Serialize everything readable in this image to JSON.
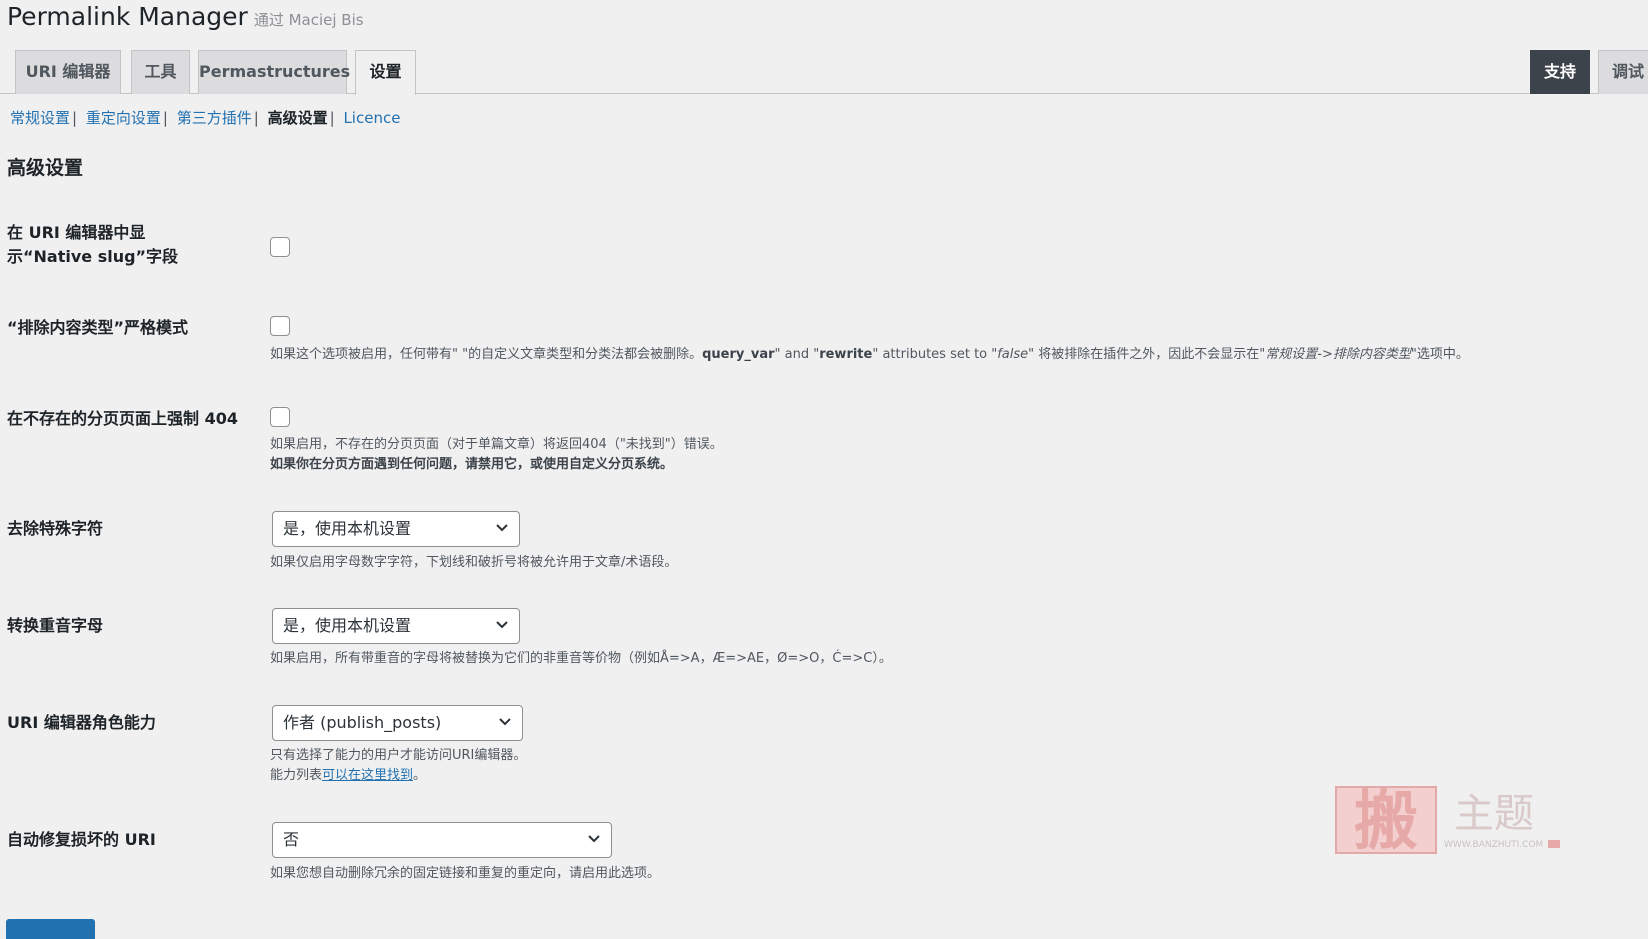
{
  "header": {
    "title": "Permalink Manager",
    "author": "通过 Maciej Bis"
  },
  "tabs": [
    {
      "label": "URI 编辑器"
    },
    {
      "label": "工具"
    },
    {
      "label": "Permastructures"
    },
    {
      "label": "设置",
      "active": true
    }
  ],
  "right_tabs": [
    {
      "label": "支持"
    },
    {
      "label": "调试"
    }
  ],
  "subnav": {
    "items": [
      "常规设置",
      "重定向设置",
      "第三方插件",
      "高级设置",
      "Licence"
    ],
    "current": "高级设置",
    "separator": "|"
  },
  "section_title": "高级设置",
  "settings": {
    "native_slug": {
      "label": "在 URI 编辑器中显示“Native slug”字段",
      "checked": false
    },
    "strict_mode": {
      "label": "“排除内容类型”严格模式",
      "checked": false,
      "desc_1": "如果这个选项被启用，任何带有\" \"的自定义文章类型和分类法都会被删除。",
      "desc_qv": "query_var",
      "desc_2": "\" and \"",
      "desc_rw": "rewrite",
      "desc_3": "\" attributes set to \"",
      "desc_false": "false",
      "desc_4": "\" 将被排除在插件之外，因此不会显示在\"",
      "desc_path": "常规设置->排除内容类型",
      "desc_5": "\"选项中。"
    },
    "force_404": {
      "label": "在不存在的分页页面上强制 404",
      "checked": false,
      "desc": "如果启用，不存在的分页页面（对于单篇文章）将返回404（\"未找到\"）错误。",
      "desc_bold": "如果你在分页方面遇到任何问题，请禁用它，或使用自定义分页系统。"
    },
    "special_chars": {
      "label": "去除特殊字符",
      "value": "是，使用本机设置",
      "desc": "如果仅启用字母数字字符，下划线和破折号将被允许用于文章/术语段。"
    },
    "accents": {
      "label": "转换重音字母",
      "value": "是，使用本机设置",
      "desc": "如果启用，所有带重音的字母将被替换为它们的非重音等价物（例如Å=>A，Æ=>AE，Ø=>O，Ć=>C）。"
    },
    "role": {
      "label": "URI 编辑器角色能力",
      "value": "作者 (publish_posts)",
      "desc": "只有选择了能力的用户才能访问URI编辑器。",
      "desc_prefix": "能力列表",
      "desc_link": "可以在这里找到",
      "desc_suffix": "。"
    },
    "autofix": {
      "label": "自动修复损坏的 URI",
      "value": "否",
      "desc": "如果您想自动删除冗余的固定链接和重复的重定向，请启用此选项。"
    }
  },
  "watermark": {
    "text": "主题",
    "url": "WWW.BANZHUTI.COM"
  },
  "colors": {
    "link": "#2271b1",
    "support_tab": "#3c434a",
    "background": "#f0f0f1"
  }
}
